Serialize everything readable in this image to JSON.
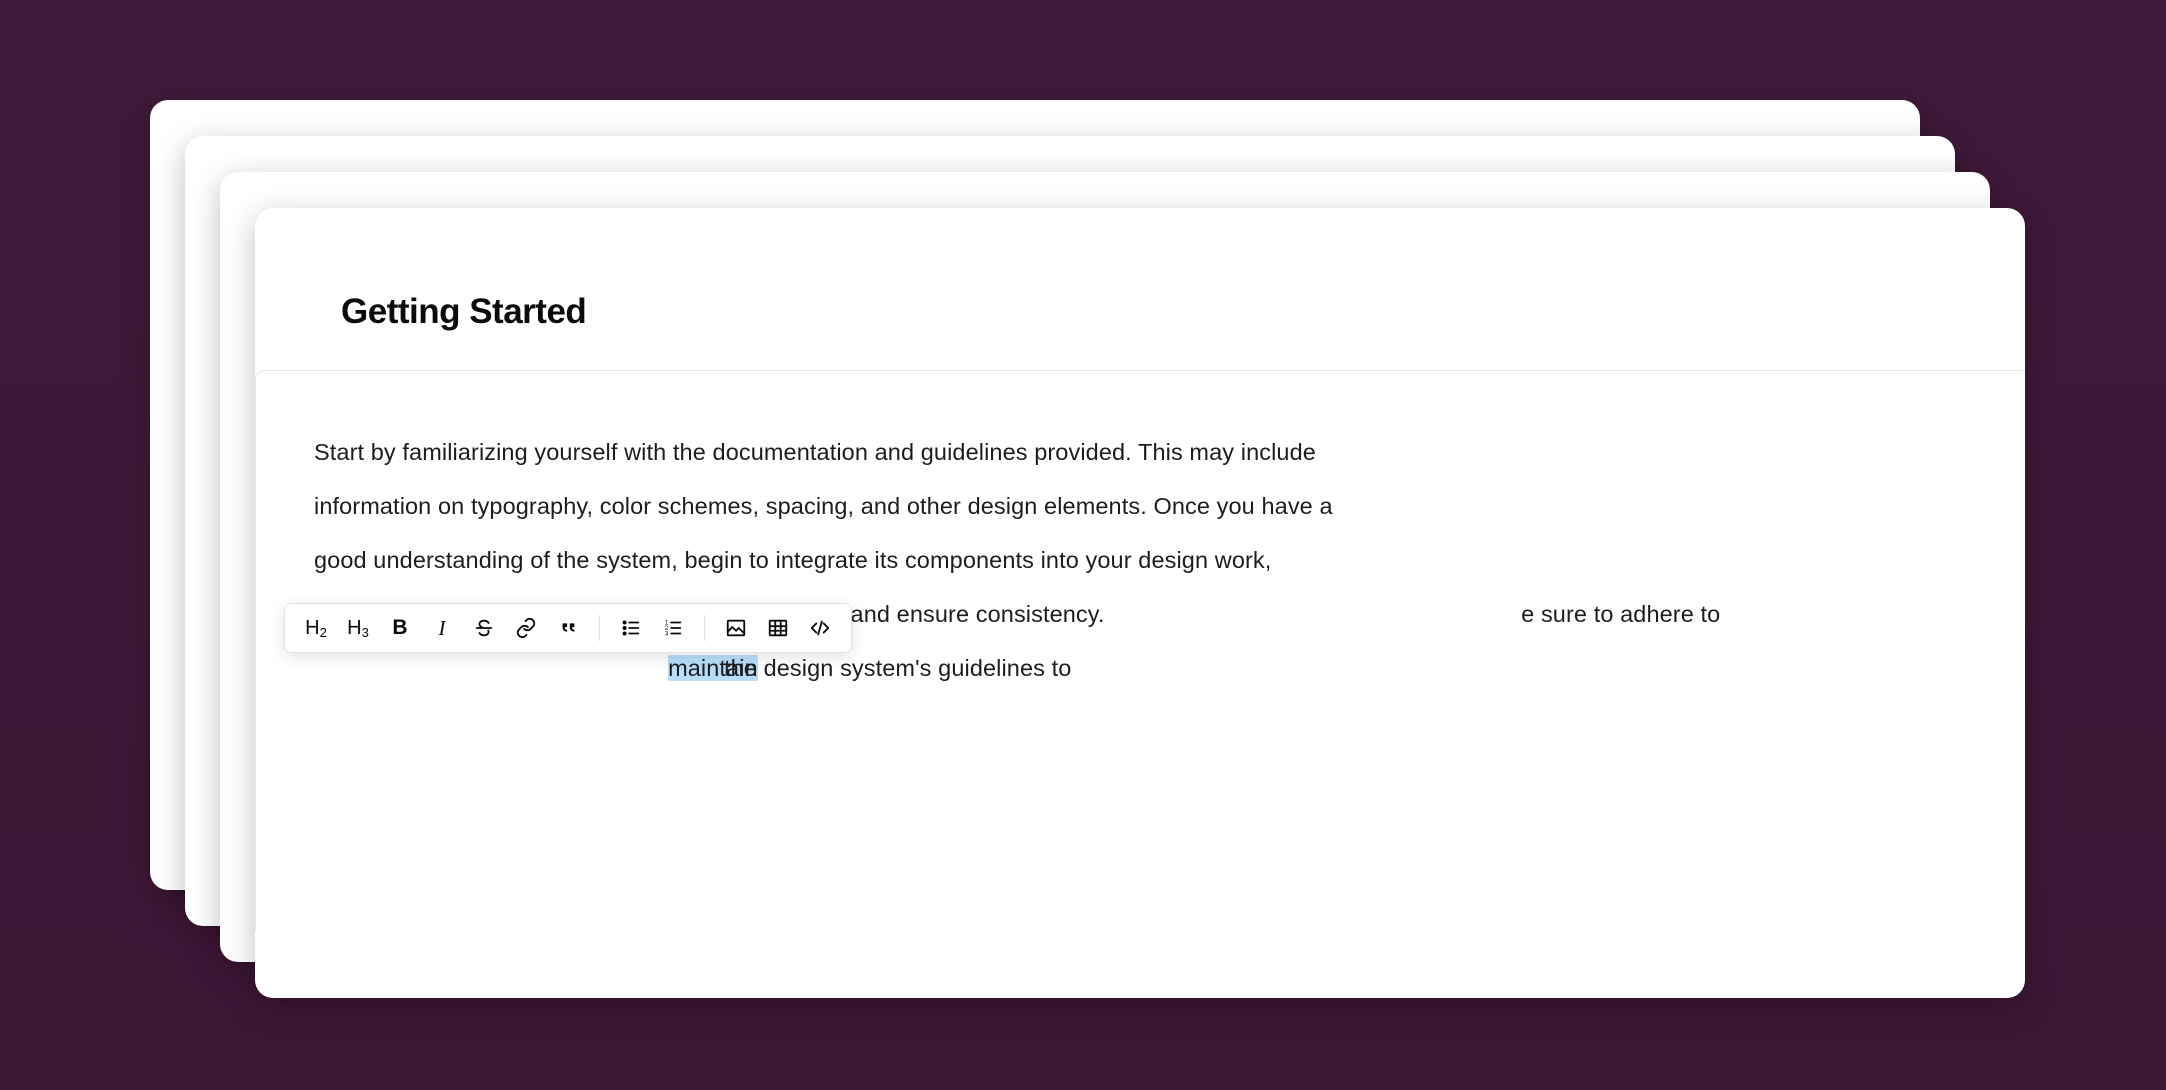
{
  "document": {
    "title": "Getting Started",
    "paragraph_before_toolbar": "Start by familiarizing yourself with the documentation and guidelines provided. This may include information on typography, color schemes, spacing, and other design elements. Once you have a good understanding of the system, begin to integrate its components into your design work, using pre-made assets and templates to save time and ensure consistency.",
    "paragraph_occluded_fragment": "e sure to adhere to the design system's guidelines to ",
    "selected_word": "maintain"
  },
  "toolbar": {
    "items": [
      {
        "name": "heading-2-button",
        "label": "H2"
      },
      {
        "name": "heading-3-button",
        "label": "H3"
      },
      {
        "name": "bold-button",
        "label": "B"
      },
      {
        "name": "italic-button",
        "label": "I"
      },
      {
        "name": "strikethrough-button",
        "label": "S"
      },
      {
        "name": "link-button",
        "label": "link"
      },
      {
        "name": "blockquote-button",
        "label": "quote"
      },
      {
        "name": "bulleted-list-button",
        "label": "bulleted list"
      },
      {
        "name": "numbered-list-button",
        "label": "numbered list"
      },
      {
        "name": "image-button",
        "label": "image"
      },
      {
        "name": "table-button",
        "label": "table"
      },
      {
        "name": "code-block-button",
        "label": "code"
      }
    ]
  }
}
